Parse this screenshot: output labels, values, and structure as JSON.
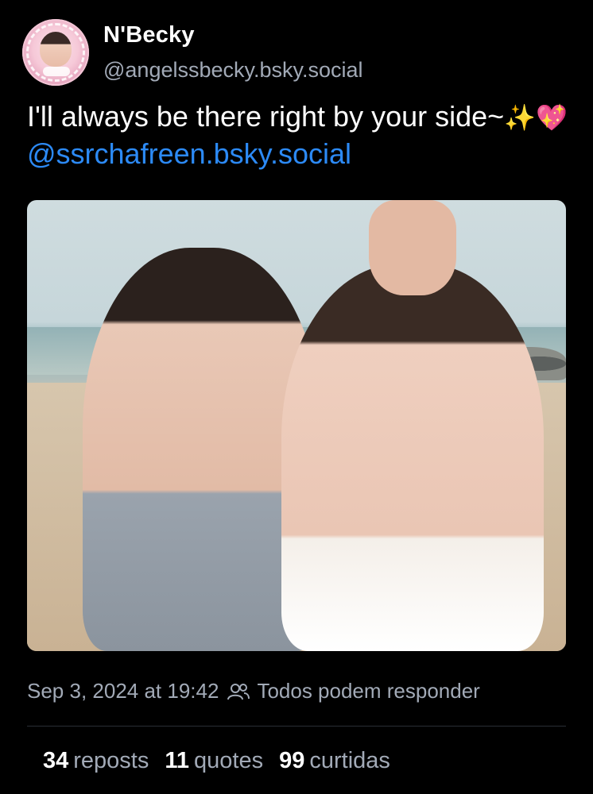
{
  "author": {
    "display_name": "N'Becky",
    "handle": "@angelssbecky.bsky.social"
  },
  "post": {
    "text_main": "I'll always be there right by your side~",
    "emojis": "✨💖",
    "mention": "@ssrchafreen.bsky.social",
    "timestamp": "Sep 3, 2024 at 19:42",
    "reply_setting": "Todos podem responder"
  },
  "stats": {
    "reposts": {
      "count": "34",
      "label": "reposts"
    },
    "quotes": {
      "count": "11",
      "label": "quotes"
    },
    "likes": {
      "count": "99",
      "label": "curtidas"
    }
  },
  "colors": {
    "background": "#000000",
    "link": "#2c8af6",
    "muted": "#a2aab7",
    "divider": "#2a2f36"
  },
  "icons": {
    "reply_setting_icon": "people-icon"
  }
}
